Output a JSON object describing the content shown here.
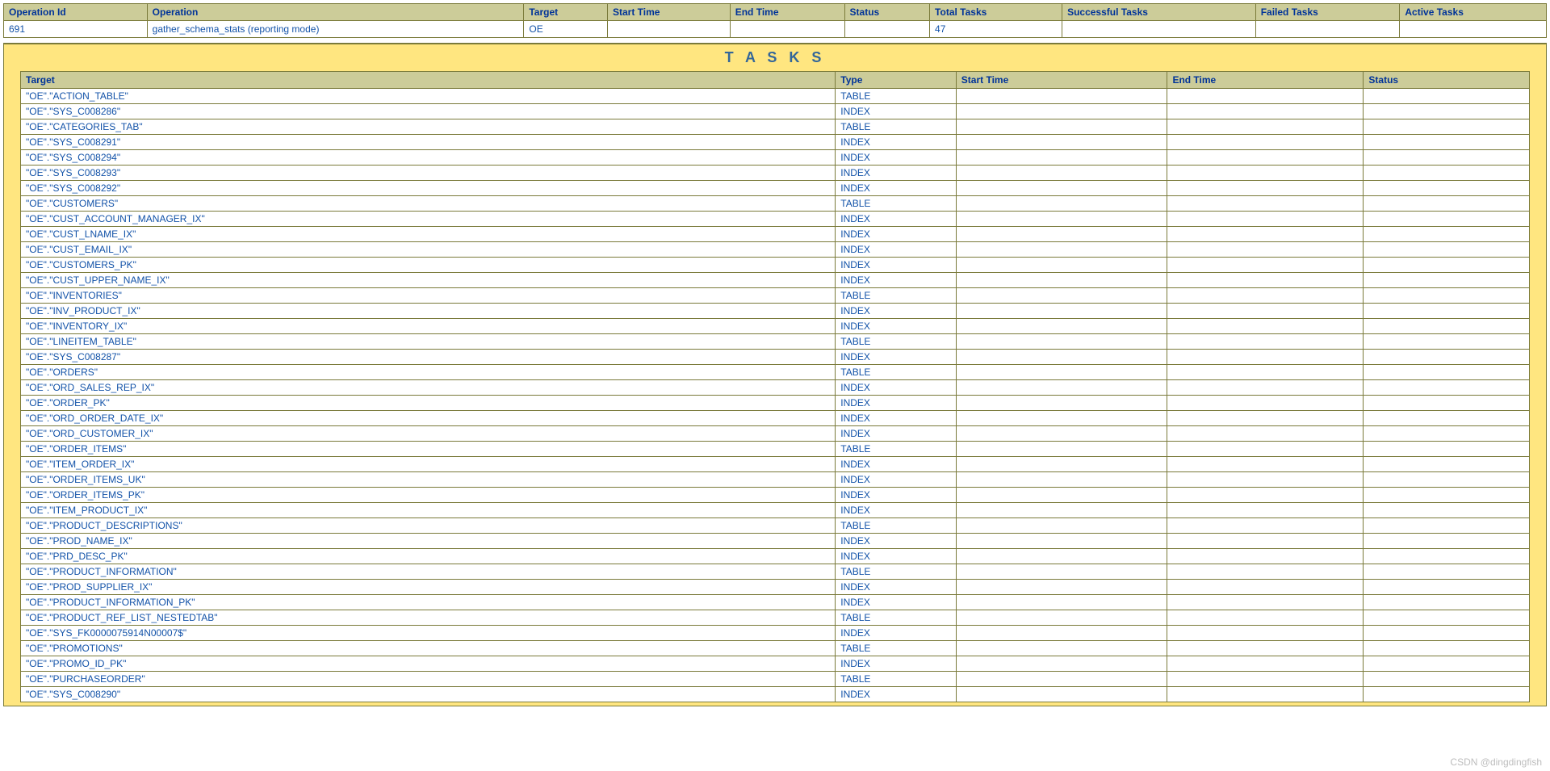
{
  "operation": {
    "headers": {
      "id": "Operation Id",
      "operation": "Operation",
      "target": "Target",
      "start_time": "Start Time",
      "end_time": "End Time",
      "status": "Status",
      "total_tasks": "Total Tasks",
      "successful_tasks": "Successful Tasks",
      "failed_tasks": "Failed Tasks",
      "active_tasks": "Active Tasks"
    },
    "row": {
      "id": "691",
      "operation": "gather_schema_stats (reporting mode)",
      "target": "OE",
      "start_time": "",
      "end_time": "",
      "status": "",
      "total_tasks": "47",
      "successful_tasks": "",
      "failed_tasks": "",
      "active_tasks": ""
    }
  },
  "tasks_panel": {
    "title": "T A S K S",
    "headers": {
      "target": "Target",
      "type": "Type",
      "start_time": "Start Time",
      "end_time": "End Time",
      "status": "Status"
    },
    "rows": [
      {
        "target": "\"OE\".\"ACTION_TABLE\"",
        "type": "TABLE",
        "start_time": "",
        "end_time": "",
        "status": ""
      },
      {
        "target": "\"OE\".\"SYS_C008286\"",
        "type": "INDEX",
        "start_time": "",
        "end_time": "",
        "status": ""
      },
      {
        "target": "\"OE\".\"CATEGORIES_TAB\"",
        "type": "TABLE",
        "start_time": "",
        "end_time": "",
        "status": ""
      },
      {
        "target": "\"OE\".\"SYS_C008291\"",
        "type": "INDEX",
        "start_time": "",
        "end_time": "",
        "status": ""
      },
      {
        "target": "\"OE\".\"SYS_C008294\"",
        "type": "INDEX",
        "start_time": "",
        "end_time": "",
        "status": ""
      },
      {
        "target": "\"OE\".\"SYS_C008293\"",
        "type": "INDEX",
        "start_time": "",
        "end_time": "",
        "status": ""
      },
      {
        "target": "\"OE\".\"SYS_C008292\"",
        "type": "INDEX",
        "start_time": "",
        "end_time": "",
        "status": ""
      },
      {
        "target": "\"OE\".\"CUSTOMERS\"",
        "type": "TABLE",
        "start_time": "",
        "end_time": "",
        "status": ""
      },
      {
        "target": "\"OE\".\"CUST_ACCOUNT_MANAGER_IX\"",
        "type": "INDEX",
        "start_time": "",
        "end_time": "",
        "status": ""
      },
      {
        "target": "\"OE\".\"CUST_LNAME_IX\"",
        "type": "INDEX",
        "start_time": "",
        "end_time": "",
        "status": ""
      },
      {
        "target": "\"OE\".\"CUST_EMAIL_IX\"",
        "type": "INDEX",
        "start_time": "",
        "end_time": "",
        "status": ""
      },
      {
        "target": "\"OE\".\"CUSTOMERS_PK\"",
        "type": "INDEX",
        "start_time": "",
        "end_time": "",
        "status": ""
      },
      {
        "target": "\"OE\".\"CUST_UPPER_NAME_IX\"",
        "type": "INDEX",
        "start_time": "",
        "end_time": "",
        "status": ""
      },
      {
        "target": "\"OE\".\"INVENTORIES\"",
        "type": "TABLE",
        "start_time": "",
        "end_time": "",
        "status": ""
      },
      {
        "target": "\"OE\".\"INV_PRODUCT_IX\"",
        "type": "INDEX",
        "start_time": "",
        "end_time": "",
        "status": ""
      },
      {
        "target": "\"OE\".\"INVENTORY_IX\"",
        "type": "INDEX",
        "start_time": "",
        "end_time": "",
        "status": ""
      },
      {
        "target": "\"OE\".\"LINEITEM_TABLE\"",
        "type": "TABLE",
        "start_time": "",
        "end_time": "",
        "status": ""
      },
      {
        "target": "\"OE\".\"SYS_C008287\"",
        "type": "INDEX",
        "start_time": "",
        "end_time": "",
        "status": ""
      },
      {
        "target": "\"OE\".\"ORDERS\"",
        "type": "TABLE",
        "start_time": "",
        "end_time": "",
        "status": ""
      },
      {
        "target": "\"OE\".\"ORD_SALES_REP_IX\"",
        "type": "INDEX",
        "start_time": "",
        "end_time": "",
        "status": ""
      },
      {
        "target": "\"OE\".\"ORDER_PK\"",
        "type": "INDEX",
        "start_time": "",
        "end_time": "",
        "status": ""
      },
      {
        "target": "\"OE\".\"ORD_ORDER_DATE_IX\"",
        "type": "INDEX",
        "start_time": "",
        "end_time": "",
        "status": ""
      },
      {
        "target": "\"OE\".\"ORD_CUSTOMER_IX\"",
        "type": "INDEX",
        "start_time": "",
        "end_time": "",
        "status": ""
      },
      {
        "target": "\"OE\".\"ORDER_ITEMS\"",
        "type": "TABLE",
        "start_time": "",
        "end_time": "",
        "status": ""
      },
      {
        "target": "\"OE\".\"ITEM_ORDER_IX\"",
        "type": "INDEX",
        "start_time": "",
        "end_time": "",
        "status": ""
      },
      {
        "target": "\"OE\".\"ORDER_ITEMS_UK\"",
        "type": "INDEX",
        "start_time": "",
        "end_time": "",
        "status": ""
      },
      {
        "target": "\"OE\".\"ORDER_ITEMS_PK\"",
        "type": "INDEX",
        "start_time": "",
        "end_time": "",
        "status": ""
      },
      {
        "target": "\"OE\".\"ITEM_PRODUCT_IX\"",
        "type": "INDEX",
        "start_time": "",
        "end_time": "",
        "status": ""
      },
      {
        "target": "\"OE\".\"PRODUCT_DESCRIPTIONS\"",
        "type": "TABLE",
        "start_time": "",
        "end_time": "",
        "status": ""
      },
      {
        "target": "\"OE\".\"PROD_NAME_IX\"",
        "type": "INDEX",
        "start_time": "",
        "end_time": "",
        "status": ""
      },
      {
        "target": "\"OE\".\"PRD_DESC_PK\"",
        "type": "INDEX",
        "start_time": "",
        "end_time": "",
        "status": ""
      },
      {
        "target": "\"OE\".\"PRODUCT_INFORMATION\"",
        "type": "TABLE",
        "start_time": "",
        "end_time": "",
        "status": ""
      },
      {
        "target": "\"OE\".\"PROD_SUPPLIER_IX\"",
        "type": "INDEX",
        "start_time": "",
        "end_time": "",
        "status": ""
      },
      {
        "target": "\"OE\".\"PRODUCT_INFORMATION_PK\"",
        "type": "INDEX",
        "start_time": "",
        "end_time": "",
        "status": ""
      },
      {
        "target": "\"OE\".\"PRODUCT_REF_LIST_NESTEDTAB\"",
        "type": "TABLE",
        "start_time": "",
        "end_time": "",
        "status": ""
      },
      {
        "target": "\"OE\".\"SYS_FK0000075914N00007$\"",
        "type": "INDEX",
        "start_time": "",
        "end_time": "",
        "status": ""
      },
      {
        "target": "\"OE\".\"PROMOTIONS\"",
        "type": "TABLE",
        "start_time": "",
        "end_time": "",
        "status": ""
      },
      {
        "target": "\"OE\".\"PROMO_ID_PK\"",
        "type": "INDEX",
        "start_time": "",
        "end_time": "",
        "status": ""
      },
      {
        "target": "\"OE\".\"PURCHASEORDER\"",
        "type": "TABLE",
        "start_time": "",
        "end_time": "",
        "status": ""
      },
      {
        "target": "\"OE\".\"SYS_C008290\"",
        "type": "INDEX",
        "start_time": "",
        "end_time": "",
        "status": ""
      }
    ]
  },
  "watermark": "CSDN @dingdingfish"
}
